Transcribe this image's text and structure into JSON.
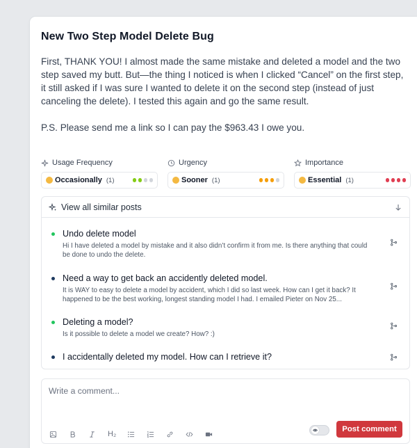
{
  "post": {
    "title": "New Two Step Model Delete Bug",
    "paragraphs": [
      "First, THANK YOU! I almost made the same mistake and deleted a model and the two step saved my butt. But—the thing I noticed is when I clicked “Cancel” on the first step, it still asked if I was sure I wanted to delete it on the second step (instead of just canceling the delete). I tested this again and go the same result.",
      "P.S. Please send me a link so I can pay the $963.43 I owe you."
    ]
  },
  "meta": {
    "usage": {
      "label": "Usage Frequency",
      "value": "Occasionally",
      "count": "(1)",
      "level": 2,
      "color": "#84cc16",
      "icon": "sparkle-icon"
    },
    "urgency": {
      "label": "Urgency",
      "value": "Sooner",
      "count": "(1)",
      "level": 3,
      "color": "#f59e0b",
      "icon": "clock-icon"
    },
    "importance": {
      "label": "Importance",
      "value": "Essential",
      "count": "(1)",
      "level": 4,
      "color": "#e03e52",
      "icon": "star-icon"
    }
  },
  "similar": {
    "header": "View all similar posts",
    "posts": [
      {
        "title": "Undo delete model",
        "desc": "Hi I have deleted a model by mistake and it also didn’t confirm it from me. Is there anything that could be done to undo the delete.",
        "status_color": "#22c55e"
      },
      {
        "title": "Need a way to get back an accidently deleted model.",
        "desc": "It is WAY to easy to delete a model by accident, which I did so last week. How can I get it back? It happened to be the best working, longest standing model I had. I emailed Pieter on Nov 25...",
        "status_color": "#1e3a5f"
      },
      {
        "title": "Deleting a model?",
        "desc": "Is it possible to delete a model we create? How? :)",
        "status_color": "#22c55e"
      },
      {
        "title": "I accidentally deleted my model. How can I retrieve it?",
        "desc": "",
        "status_color": "#1e3a5f"
      }
    ]
  },
  "comment": {
    "placeholder": "Write a comment...",
    "heading_tool": "H₂",
    "submit_label": "Post comment",
    "submit_color": "#d0383d"
  }
}
